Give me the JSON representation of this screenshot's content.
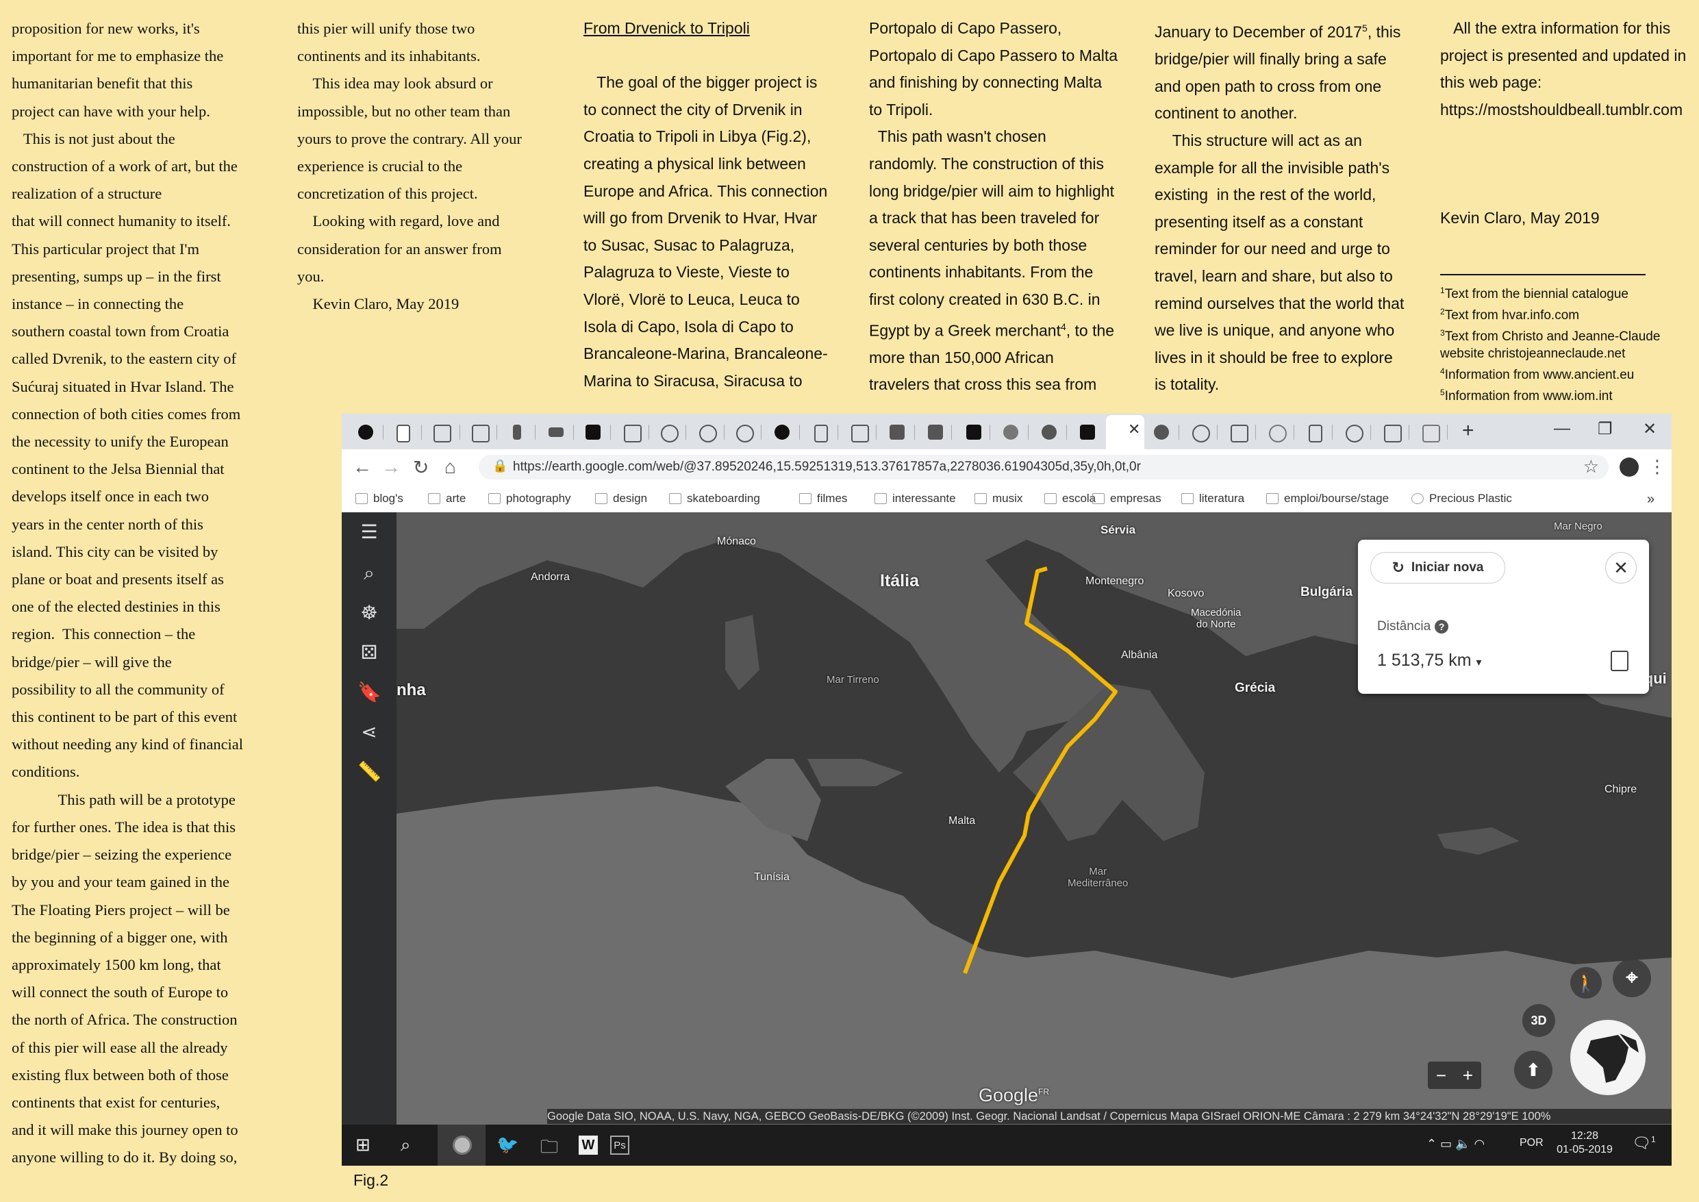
{
  "col1": "proposition for new works, it's\nimportant for me to emphasize the\nhumanitarian benefit that this\nproject can have with your help.\n   This is not just about the\nconstruction of a work of art, but the\nrealization of a structure\nthat will connect humanity to itself.\nThis particular project that I'm\npresenting, sumps up – in the first\ninstance – in connecting the\nsouthern coastal town from Croatia\ncalled Dvrenik, to the eastern city of\nSućuraj situated in Hvar Island. The\nconnection of both cities comes from\nthe necessity to unify the European\ncontinent to the Jelsa Biennial that\ndevelops itself once in each two\nyears in the center north of this\nisland. This city can be visited by\nplane or boat and presents itself as\none of the elected destinies in this\nregion.  This connection – the\nbridge/pier – will give the\npossibility to all the community of\nthis continent to be part of this event\nwithout needing any kind of financial\nconditions.\n            This path will be a prototype\nfor further ones. The idea is that this\nbridge/pier – seizing the experience\nby you and your team gained in the\nThe Floating Piers project – will be\nthe beginning of a bigger one, with\napproximately 1500 km long, that\nwill connect the south of Europe to\nthe north of Africa. The construction\nof this pier will ease all the already\nexisting flux between both of those\ncontinents that exist for centuries,\nand it will make this journey open to\nanyone willing to do it. By doing so,",
  "col2": "this pier will unify those two\ncontinents and its inhabitants.\n    This idea may look absurd or\nimpossible, but no other team than\nyours to prove the contrary. All your\nexperience is crucial to the\nconcretization of this project.\n    Looking with regard, love and\nconsideration for an answer from\nyou.\n    Kevin Claro, May 2019",
  "col3_heading": "From Drvenick to Tripoli",
  "col3": "   The goal of the bigger project is\nto connect the city of Drvenik in\nCroatia to Tripoli in Libya (Fig.2),\ncreating a physical link between\nEurope and Africa. This connection\nwill go from Drvenik to Hvar, Hvar\nto Susac, Susac to Palagruza,\nPalagruza to Vieste, Vieste to\nVlorë, Vlorë to Leuca, Leuca to\nIsola di Capo, Isola di Capo to\nBrancaleone-Marina, Brancaleone-\nMarina to Siracusa, Siracusa to",
  "col4_a": "Portopalo di Capo Passero,\nPortopalo di Capo Passero to Malta\nand finishing by connecting Malta\nto Tripoli.\n  This path wasn't chosen\nrandomly. The construction of this\nlong bridge/pier will aim to highlight\na track that has been traveled for\nseveral centuries by both those\ncontinents inhabitants. From the\nfirst colony created in 630 B.C. in\nEgypt by a Greek merchant",
  "col4_sup": "4",
  "col4_b": ", to the\nmore than 150,000 African\ntravelers that cross this sea from",
  "col5_a": "January to December of 2017",
  "col5_sup": "5",
  "col5_b": ", this\nbridge/pier will finally bring a safe\nand open path to cross from one\ncontinent to another.\n    This structure will act as an\nexample for all the invisible path's\nexisting  in the rest of the world,\npresenting itself as a constant\nreminder for our need and urge to\ntravel, learn and share, but also to\nremind ourselves that the world that\nwe live is unique, and anyone who\nlives in it should be free to explore\nis totality.",
  "col6": "   All the extra information for this\nproject is presented and updated in\nthis web page:\nhttps://mostshouldbeall.tumblr.com\n\n\n\nKevin Claro, May 2019",
  "footnotes": [
    {
      "n": "1",
      "text": "Text from the biennial catalogue"
    },
    {
      "n": "2",
      "text": "Text from hvar.info.com"
    },
    {
      "n": "3",
      "text": "Text from Christo and Jeanne-Claude website christojeanneclaude.net"
    },
    {
      "n": "4",
      "text": "Information from www.ancient.eu"
    },
    {
      "n": "5",
      "text": "Information from www.iom.int"
    }
  ],
  "fig_caption": "Fig.2",
  "browser": {
    "url": "https://earth.google.com/web/@37.89520246,15.59251319,513.37617857a,2278036.61904305d,35y,0h,0t,0r",
    "bookmarks": [
      "blog's",
      "arte",
      "photography",
      "design",
      "skateboarding",
      "filmes",
      "interessante",
      "musix",
      "escola",
      "empresas",
      "literatura",
      "emploi/bourse/stage",
      "Precious Plastic"
    ],
    "bookmarks_more": "»",
    "new_tab": "+"
  },
  "map": {
    "labels": {
      "monaco": "Mónaco",
      "andorra": "Andorra",
      "italia": "Itália",
      "servia": "Sérvia",
      "montenegro": "Montenegro",
      "kosovo": "Kosovo",
      "bulgaria": "Bulgária",
      "macedonia": "Macedónia\ndo Norte",
      "albania": "Albânia",
      "grecia": "Grécia",
      "mar_tirreno": "Mar Tirreno",
      "malta": "Malta",
      "tunisia": "Tunísia",
      "mar_med": "Mar\nMediterrâneo",
      "chipre": "Chipre",
      "turquia": "Turqui",
      "espanha": "nha",
      "mar_negro": "Mar Negro"
    },
    "panel": {
      "new_button": "Iniciar nova",
      "distance_label": "Distância",
      "help": "?",
      "distance_value": "1 513,75 km"
    },
    "btn_3d": "3D",
    "google": "Google",
    "google_fr": "FR",
    "attribution": "Google Data SIO, NOAA, U.S. Navy, NGA, GEBCO GeoBasis-DE/BKG (©2009) Inst. Geogr. Nacional Landsat / Copernicus Mapa GISrael ORION-ME   Câmara :  2 279 km  34°24'32\"N 28°29'19\"E  100%",
    "route_color": "#f5b800"
  },
  "taskbar": {
    "lang": "POR",
    "time": "12:28",
    "date": "01-05-2019",
    "notif": "1"
  }
}
